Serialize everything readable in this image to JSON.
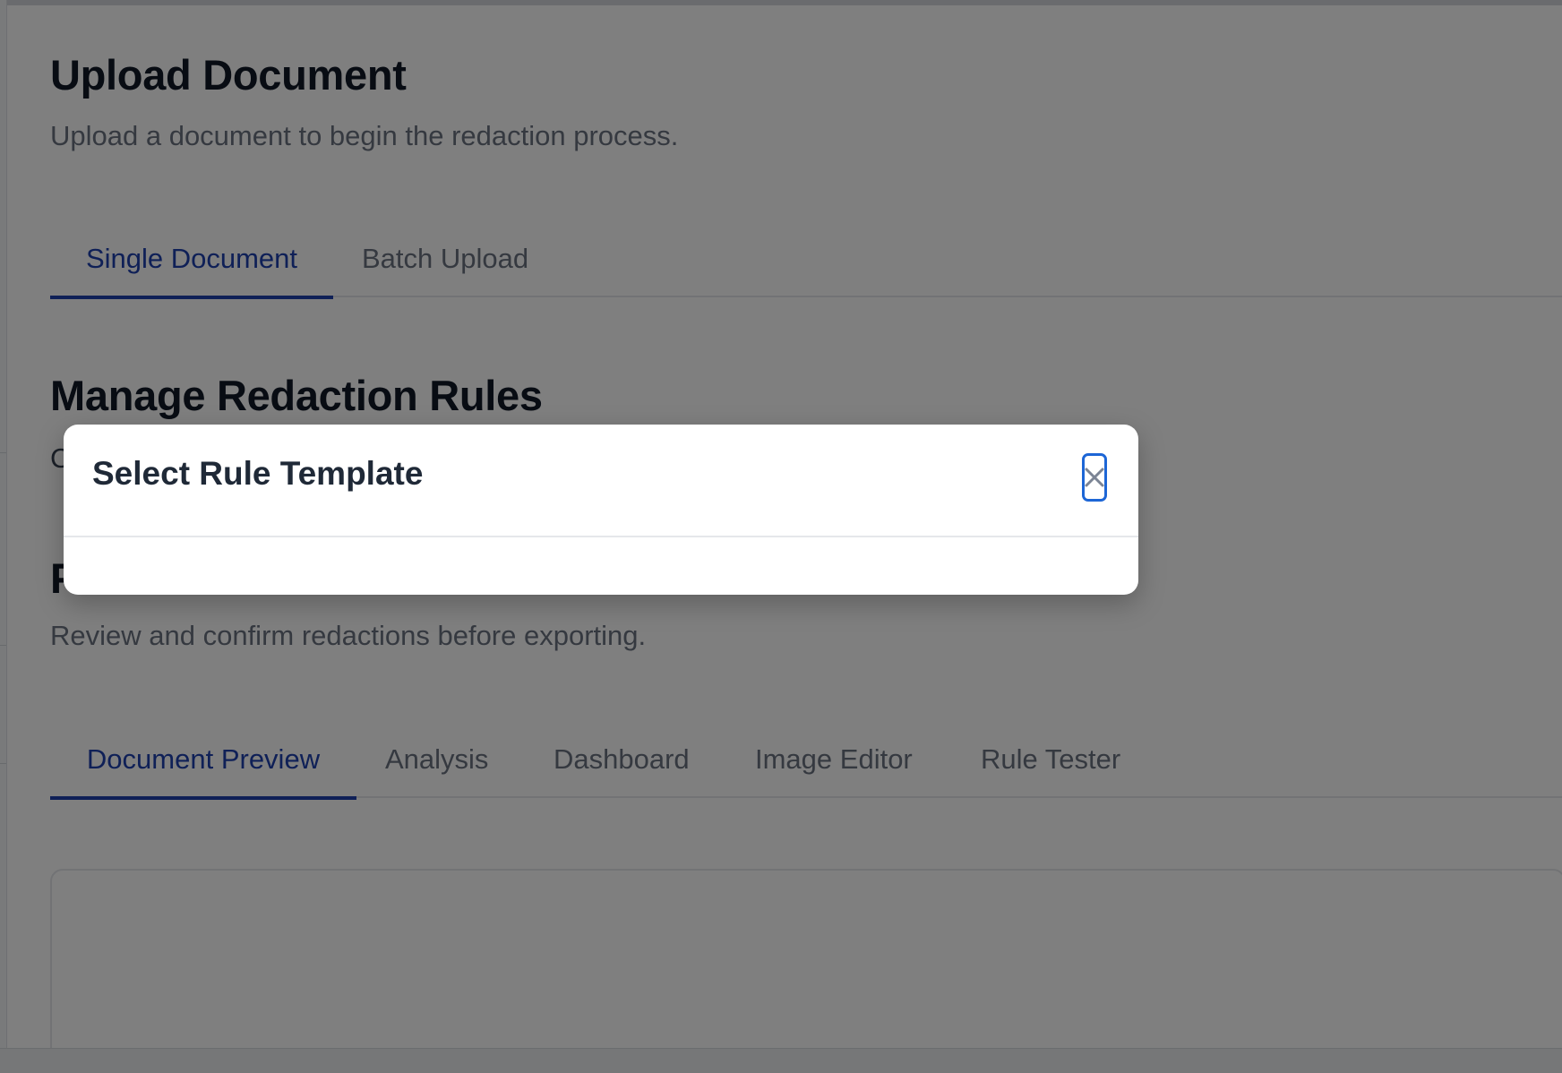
{
  "upload": {
    "title": "Upload Document",
    "description": "Upload a document to begin the redaction process.",
    "tabs": [
      {
        "label": "Single Document",
        "active": true
      },
      {
        "label": "Batch Upload",
        "active": false
      }
    ]
  },
  "rules": {
    "title": "Manage Redaction Rules",
    "description_partial": "C"
  },
  "review": {
    "title_partial": "P",
    "description": "Review and confirm redactions before exporting.",
    "tabs": [
      {
        "label": "Document Preview",
        "active": true
      },
      {
        "label": "Analysis",
        "active": false
      },
      {
        "label": "Dashboard",
        "active": false
      },
      {
        "label": "Image Editor",
        "active": false
      },
      {
        "label": "Rule Tester",
        "active": false
      }
    ]
  },
  "modal": {
    "title": "Select Rule Template",
    "close_icon": "close-icon"
  },
  "colors": {
    "accent": "#1e40af",
    "focus_ring": "#1d66d6",
    "overlay": "rgba(0,0,0,0.5)"
  }
}
